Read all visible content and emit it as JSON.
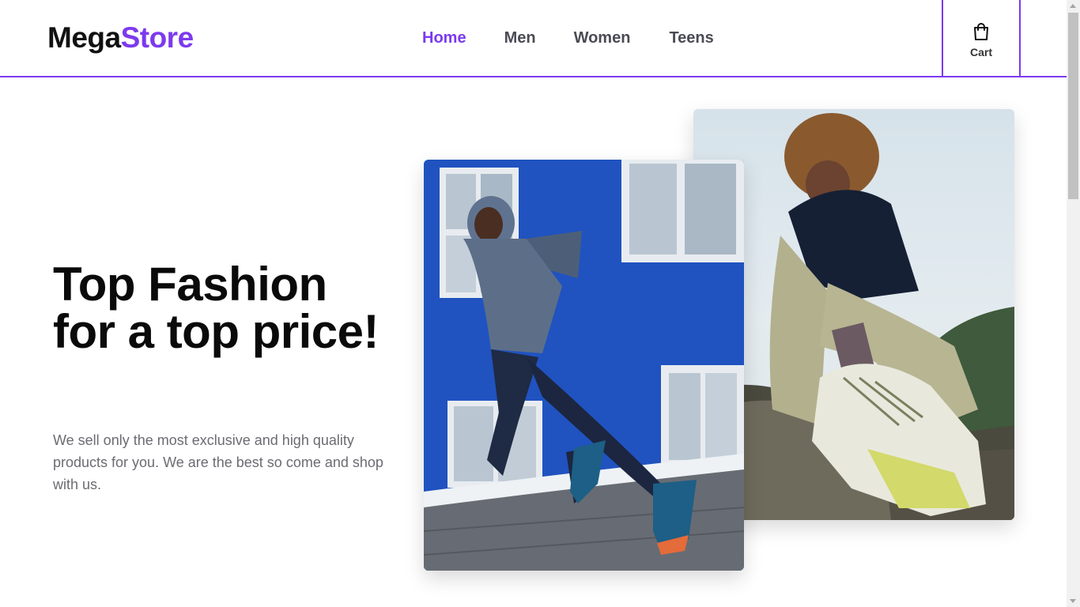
{
  "brand": {
    "part1": "Mega",
    "part2": "Store"
  },
  "nav": [
    {
      "label": "Home",
      "active": true
    },
    {
      "label": "Men",
      "active": false
    },
    {
      "label": "Women",
      "active": false
    },
    {
      "label": "Teens",
      "active": false
    }
  ],
  "cart": {
    "label": "Cart",
    "icon": "shopping-bag-icon"
  },
  "hero": {
    "title": "Top Fashion for a top price!",
    "subtitle": "We sell only the most exclusive and high quality products for you. We are the best so come and shop with us."
  },
  "colors": {
    "accent": "#7c3aed",
    "text": "#111111",
    "muted": "#6b6b72"
  }
}
